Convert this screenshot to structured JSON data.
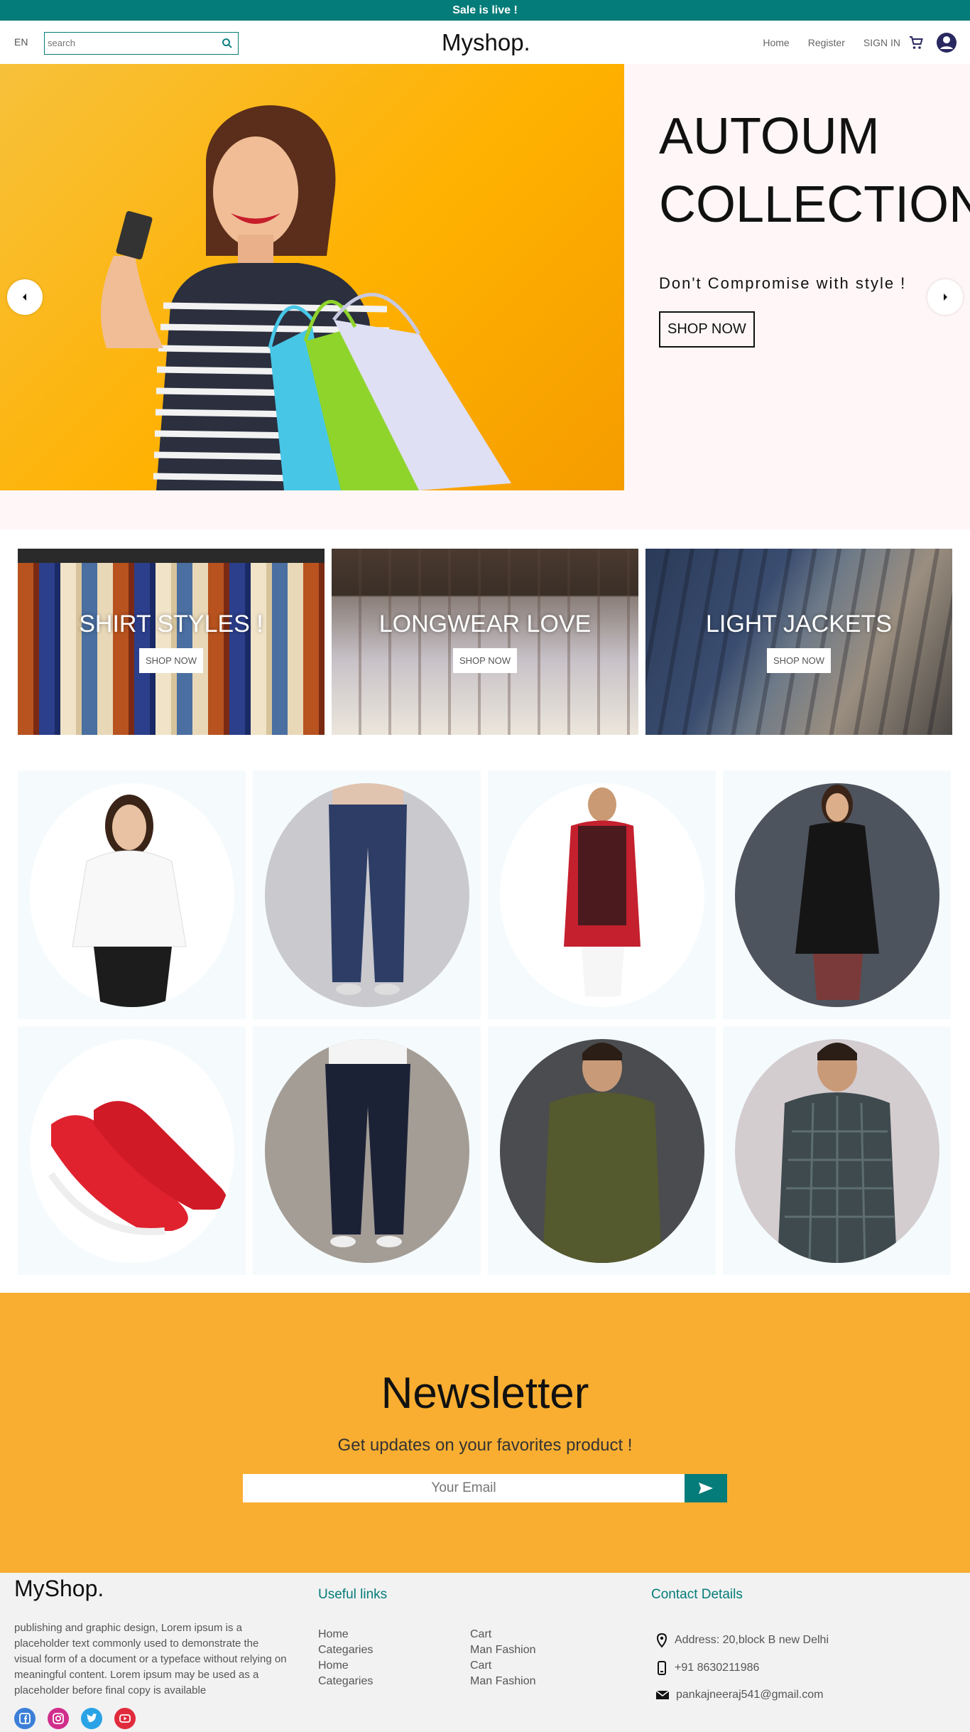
{
  "announcement": "Sale is live !",
  "nav": {
    "lang": "EN",
    "search_placeholder": "search",
    "logo": "Myshop.",
    "links": [
      "Home",
      "Register",
      "SIGN IN"
    ],
    "icons": [
      "search-icon",
      "cart-icon",
      "user-account-icon"
    ],
    "accent": "#047c79"
  },
  "hero": {
    "title_line1": "AUTOUM",
    "title_line2": "COLLECTION",
    "subtitle": "Don't Compromise with style !",
    "button": "SHOP NOW",
    "image": "woman-with-shopping-bags-photo",
    "bg_color": "#ffb100"
  },
  "categories": [
    {
      "title": "SHIRT STYLES !",
      "button": "SHOP NOW",
      "image": "shirt-rack-photo"
    },
    {
      "title": "LONGWEAR LOVE",
      "button": "SHOP NOW",
      "image": "dress-rack-photo"
    },
    {
      "title": "LIGHT JACKETS",
      "button": "SHOP NOW",
      "image": "jacket-rack-photo"
    }
  ],
  "products": [
    {
      "name": "white-shirt-woman",
      "circle": "#ffffff"
    },
    {
      "name": "ripped-blue-jeans",
      "circle": "#c9c9ce"
    },
    {
      "name": "kurta-with-jacket",
      "circle": "#ffffff"
    },
    {
      "name": "black-kurta-set",
      "circle": "#4d545e"
    },
    {
      "name": "red-sneakers",
      "circle": "#ffffff"
    },
    {
      "name": "dark-jeans",
      "circle": "#a49d96"
    },
    {
      "name": "olive-shirt-man",
      "circle": "#4a4c4f"
    },
    {
      "name": "checked-shirt-man",
      "circle": "#d4cdd0"
    }
  ],
  "newsletter": {
    "title": "Newsletter",
    "description": "Get updates on your favorites product !",
    "placeholder": "Your Email",
    "bg_color": "#f9ae31"
  },
  "footer": {
    "logo": "MyShop.",
    "description": "publishing and graphic design, Lorem ipsum is a placeholder text commonly used to demonstrate the visual form of a document or a typeface without relying on meaningful content. Lorem ipsum may be used as a placeholder before final copy is available",
    "socials": [
      "facebook-icon",
      "instagram-icon",
      "twitter-icon",
      "youtube-icon"
    ],
    "useful_links_title": "Useful links",
    "links_col1": [
      "Home",
      "Categaries",
      "Home",
      "Categaries"
    ],
    "links_col2": [
      "Cart",
      "Man Fashion",
      "Cart",
      "Man Fashion"
    ],
    "contact_title": "Contact Details",
    "address": "Address: 20,block B new Delhi",
    "phone": "+91 8630211986",
    "email": "pankajneeraj541@gmail.com"
  }
}
